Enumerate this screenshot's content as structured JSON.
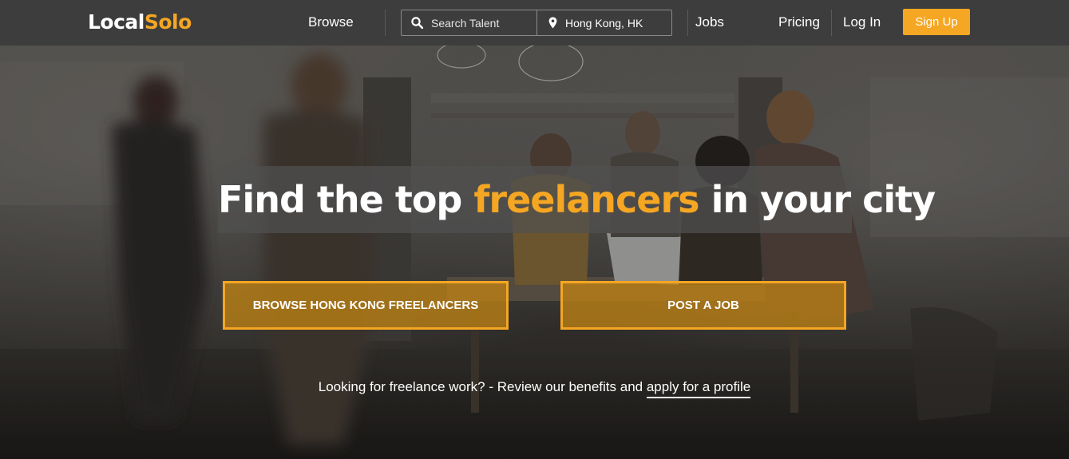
{
  "brand": {
    "part1": "Local",
    "part2": "Solo",
    "accent_color": "#f5a623"
  },
  "nav": {
    "browse": "Browse",
    "search_placeholder": "Search Talent",
    "location_value": "Hong Kong, HK",
    "jobs": "Jobs",
    "pricing": "Pricing",
    "login": "Log In",
    "signup": "Sign Up"
  },
  "hero": {
    "headline_pre": "Find the top ",
    "headline_accent": "freelancers",
    "headline_post": " in your city",
    "browse_button": "BROWSE HONG KONG FREELANCERS",
    "post_job_button": "POST A JOB",
    "footnote_text": "Looking for freelance work? - Review our benefits and ",
    "footnote_link": "apply for a profile"
  },
  "icons": {
    "search": "search-icon",
    "location": "map-pin-icon"
  }
}
